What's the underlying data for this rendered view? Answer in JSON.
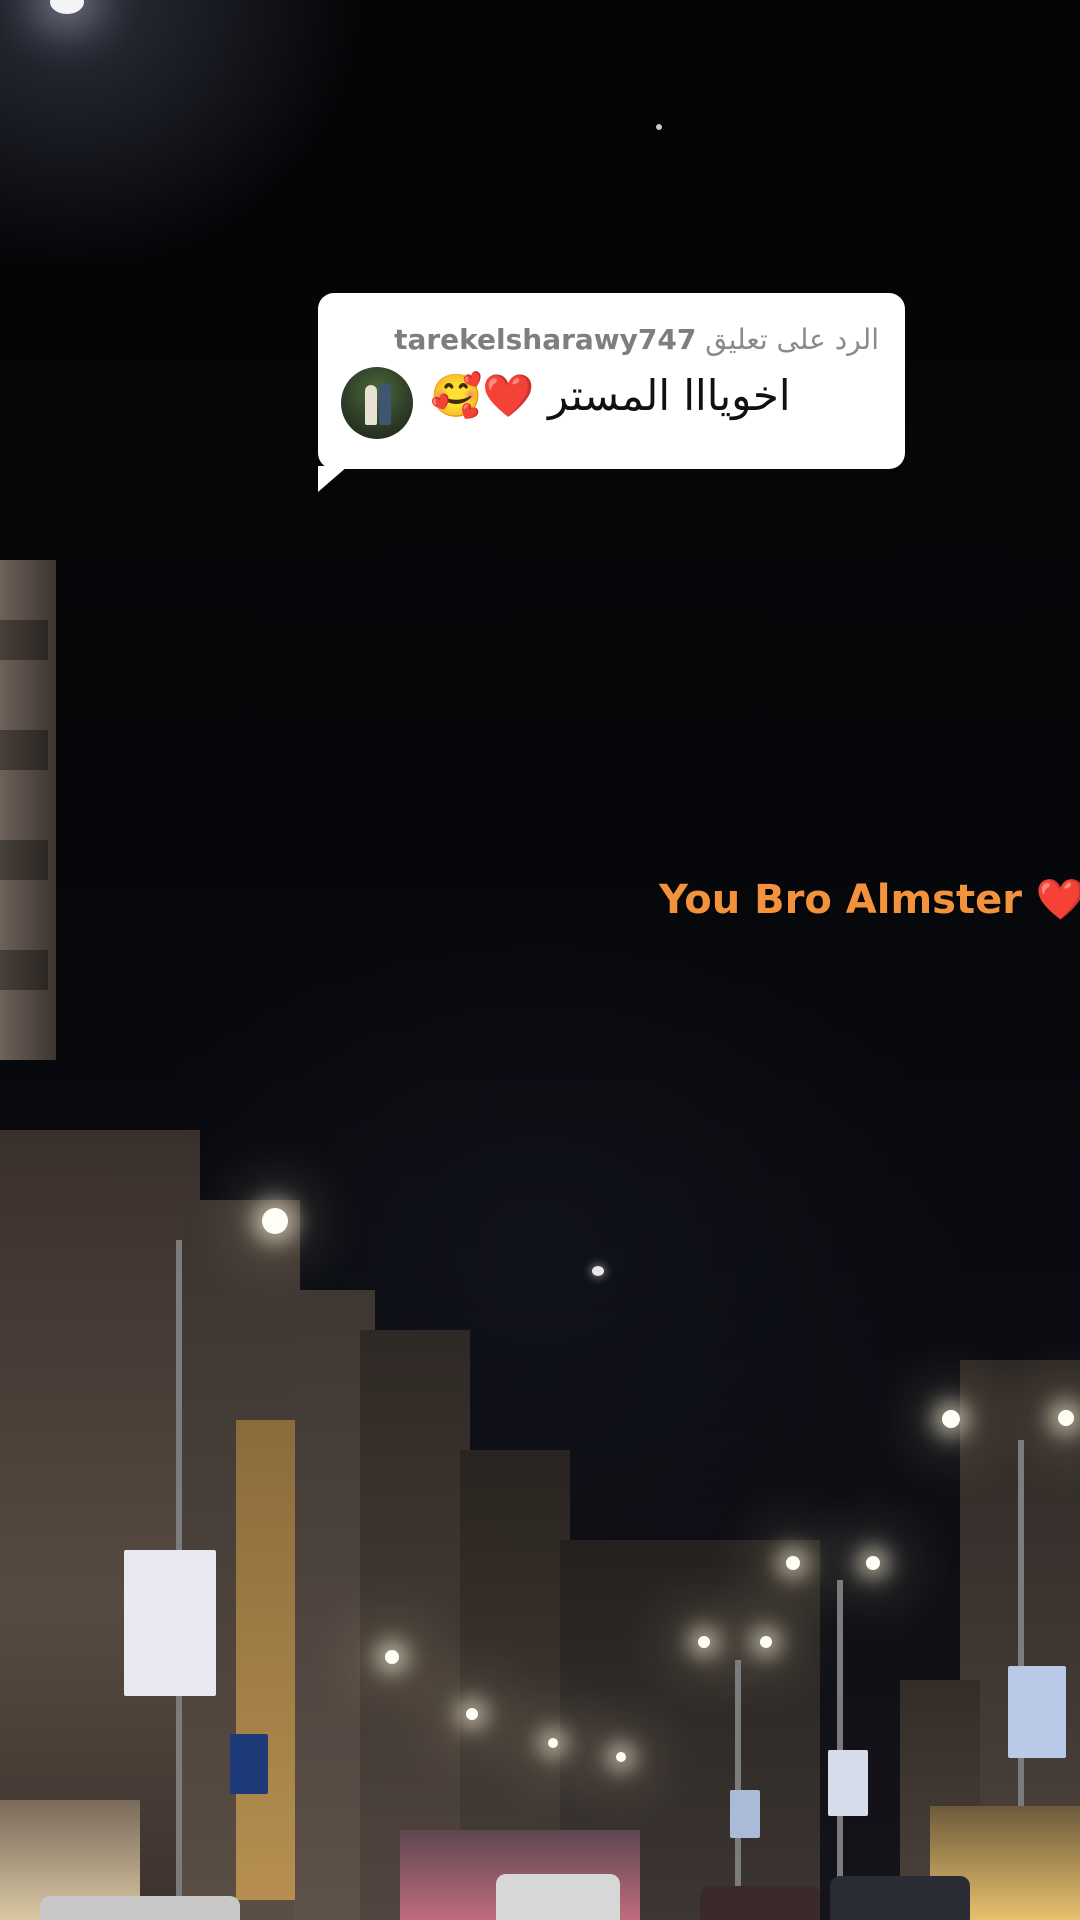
{
  "reply": {
    "prefix": "الرد على تعليق",
    "username": "tarekelsharawy747",
    "comment": "اخويااا المستر ❤️🥰"
  },
  "caption": "You Bro Almster ❤️",
  "colors": {
    "caption": "#f2923c",
    "bubble": "#ffffff",
    "sky": "#050507"
  }
}
